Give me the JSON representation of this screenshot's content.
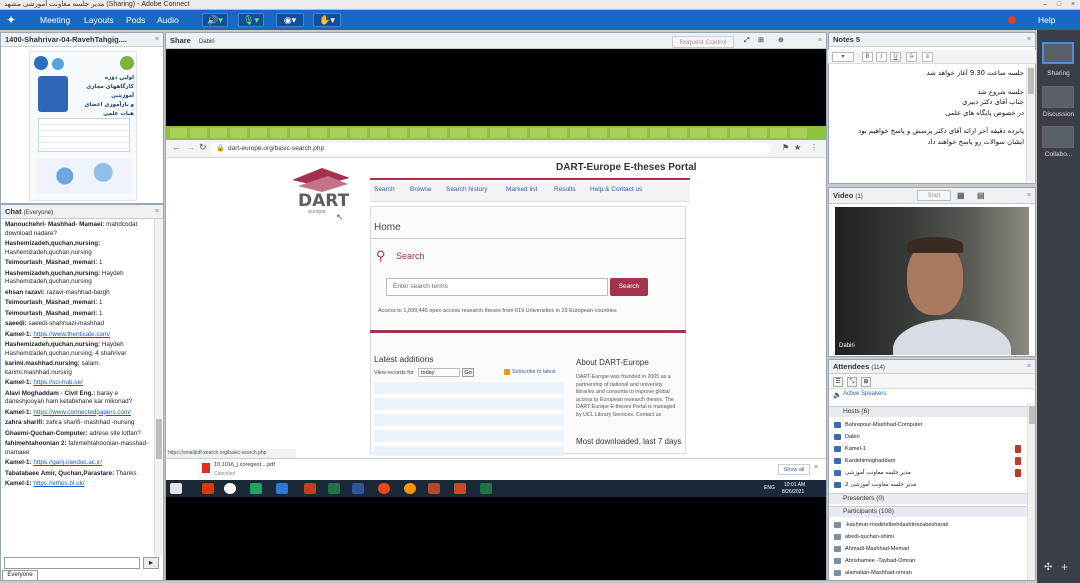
{
  "window": {
    "title": "مدير جلسه معاونت آموزشی مشهد (Sharing) - Adobe Connect"
  },
  "menu": {
    "items": [
      "Meeting",
      "Layouts",
      "Pods",
      "Audio"
    ],
    "help": "Help"
  },
  "colors": {
    "menubar": "#1769c4",
    "accent": "#a4324d",
    "record": "#e23c30"
  },
  "document_pod": {
    "title": "1400-Shahrivar-04-RavehTahgig...."
  },
  "poster": {
    "line1": "اولین دوره",
    "line2": "کارگاههای مجازی آموزشی",
    "line3": "و بازآموزی اعضای هیات علمی"
  },
  "chat": {
    "title": "Chat",
    "audience": "(Everyone)",
    "tab": "Everyone",
    "messages": [
      {
        "name": "Manouchehri- Mashhad- Mamaei:",
        "text": " mahdcodat download nadare?"
      },
      {
        "name": "Hashemizadeh,quchan,nursing:",
        "text": " Hashemizadeh,quchan,nursing"
      },
      {
        "name": "Teimourtash_Mashad_memari:",
        "text": " 1"
      },
      {
        "name": "Hashemizadeh,quchan,nursing:",
        "text": " Haydeh Hashemizadeh,quchan,nursing"
      },
      {
        "name": "ehsan razavi:",
        "text": " razavi-mashhad-bargh"
      },
      {
        "name": "Teimourtash_Mashad_memari:",
        "text": " 1"
      },
      {
        "name": "Teimourtash_Mashad_memari:",
        "text": " 1"
      },
      {
        "name": "saeedi:",
        "text": " saeedi-shahrsazi-mashhad"
      },
      {
        "name": "Kamel-1:",
        "text": " ",
        "link": "https://www.thenticate.com/"
      },
      {
        "name": "Hashemizadeh,quchan,nursing:",
        "text": " Haydeh Hashemizadeh,quchan,nursing, 4 shahrivar"
      },
      {
        "name": "karimi.mashhad.nursing:",
        "text": " salam. karimi.mashhad.nursing"
      },
      {
        "name": "Kamel-1:",
        "text": " ",
        "link": "https://sci-hub.se/"
      },
      {
        "name": "Alavi Moghaddam - Civil Eng.:",
        "text": " baray e daneshjooyan ham ketabkhane kar mikonad?"
      },
      {
        "name": "Kamel-1:",
        "text": " ",
        "link": "https://www.connectedpapers.com/"
      },
      {
        "name": "zahra sharifi:",
        "text": " zahra sharifi- mashhad -nursing"
      },
      {
        "name": "Ghaemi-Quchan-Computer:",
        "text": " adrese site lotfan?"
      },
      {
        "name": "fahimehtahoonian 2:",
        "text": " fahimehtahoonian-masshad-mamaee"
      },
      {
        "name": "Kamel-1:",
        "text": " ",
        "link": "https://ganj.irandoc.ac.ir/"
      },
      {
        "name": "Tabatabaee Amir, Quchan,Parastare:",
        "text": " Thanks"
      },
      {
        "name": "Kamel-1:",
        "text": " ",
        "link": "https://ethos.bl.uk/"
      }
    ]
  },
  "share": {
    "title": "Share",
    "presenter": "Dabiri",
    "request_control": "Request Control"
  },
  "browser": {
    "url": "dart-europe.org/basic-search.php",
    "portal_title": "DART-Europe E-theses Portal",
    "nav": [
      "Search",
      "Browse",
      "Search history",
      "Marked list",
      "Results",
      "Help & Contact us"
    ],
    "home": "Home",
    "search_heading": "Search",
    "search_placeholder": "Enter search terms",
    "search_button": "Search",
    "access_text": "Access to 1,099,445 open access research theses from 619 Universities in 29 European countries",
    "latest_additions": "Latest additions",
    "view_records_for": "View records for",
    "period": "today",
    "go": "Go",
    "subscribe": "Subscribe to latest",
    "about_title": "About DART-Europe",
    "about_text": "DART-Europe was founded in 2005 as a partnership of national and university libraries and consortia to improve global access to European research theses. The DART-Europe E-theses Portal is managed by UCL Library Services. Contact us",
    "most_downloaded": "Most downloaded, last 7 days",
    "status_url": "https://smallpdf-search.org/basic-search.php",
    "download_file": "10.1016_j.coregeor....pdf",
    "download_status": "Canceled",
    "show_all": "Show all",
    "clock_time": "10:01 AM",
    "clock_date": "8/26/2021",
    "lang": "ENG"
  },
  "notes": {
    "title": "Notes 5",
    "lines": [
      "جلسه ساعت 9.30 آغاز خواهد شد",
      "",
      "جلسه شروع شد",
      "جناب آقای دکتر دبیری",
      "در خصوص پایگاه های علمی",
      "",
      "پانزده دقیقه آخر ارائه آقای دکتر پرسش و پاسخ خواهیم بود",
      "ایشان سوالات رو  پاسخ خواهند داد"
    ]
  },
  "video": {
    "title": "Video",
    "count": "(1)",
    "start": "Start",
    "speaker_name": "Dabiri"
  },
  "attendees": {
    "title": "Attendees",
    "count": "(114)",
    "active_speakers": "Active Speakers",
    "hosts_label": "Hosts (6)",
    "hosts": [
      "Bahrepour-Mashhad-Computer",
      "Dabiri",
      "Kamel-1",
      "Kardehimoghaddam",
      "مدیر جلسه معاونت آموزشی",
      "مدیر جلسه معاونت آموزشی 2"
    ],
    "presenters_label": "Presenters (0)",
    "participants_label": "Participants (108)",
    "participants": [
      "-kashmar-modirietbehdashtirezabesharati",
      "abedi-quchan-shimi",
      "Ahmadi-Mashhad-Memari",
      "Abrishamee -Taybad-Omran",
      "alamatian-Mashhad-omran"
    ]
  },
  "layouts": {
    "items": [
      "Sharing",
      "Discussion",
      "Collabo..."
    ]
  }
}
